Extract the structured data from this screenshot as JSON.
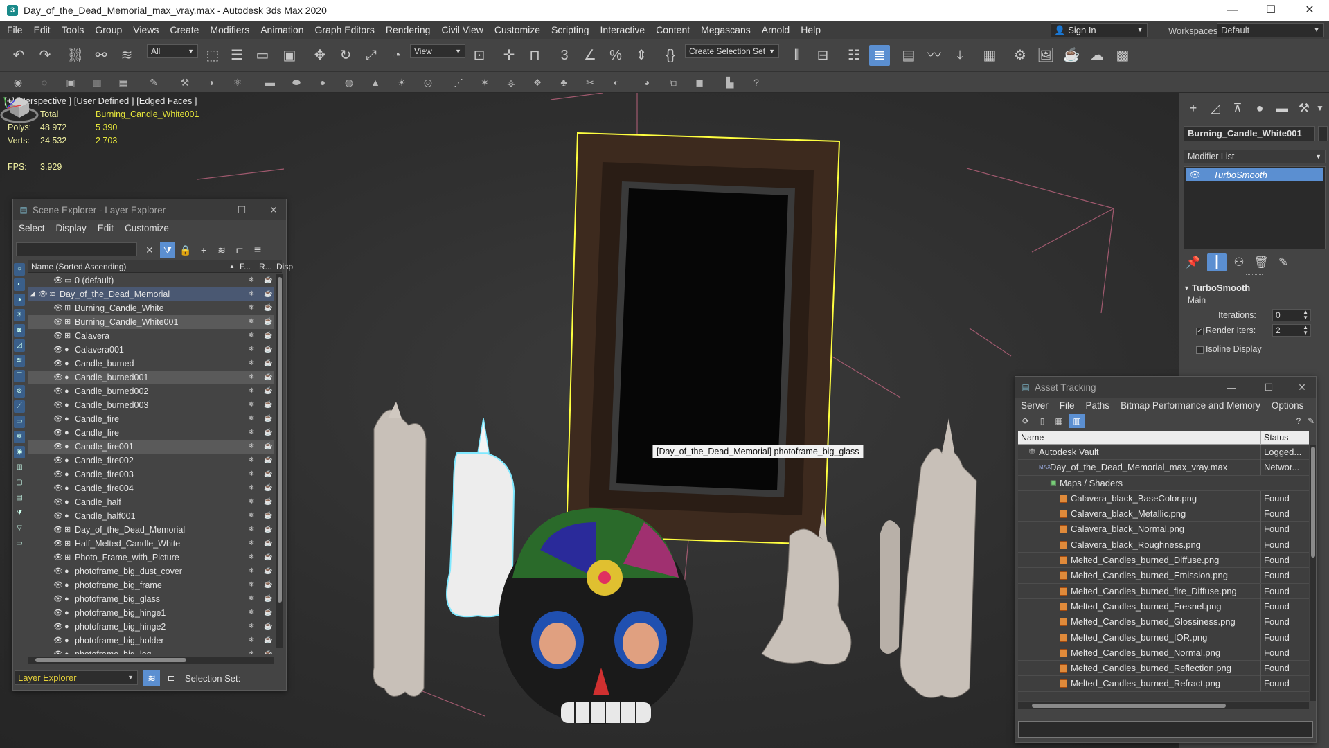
{
  "window": {
    "title": "Day_of_the_Dead_Memorial_max_vray.max - Autodesk 3ds Max 2020",
    "app_icon_letter": "3",
    "minimize": "—",
    "maximize": "☐",
    "close": "✕"
  },
  "menubar": {
    "items": [
      "File",
      "Edit",
      "Tools",
      "Group",
      "Views",
      "Create",
      "Modifiers",
      "Animation",
      "Graph Editors",
      "Rendering",
      "Civil View",
      "Customize",
      "Scripting",
      "Interactive",
      "Content",
      "Megascans",
      "Arnold",
      "Help"
    ],
    "sign_in": "Sign In",
    "workspaces_label": "Workspaces:",
    "workspace_value": "Default"
  },
  "toolbar": {
    "filter_value": "All",
    "refcoord_value": "View",
    "selection_set_placeholder": "Create Selection Set"
  },
  "viewport": {
    "label": "[+] [Perspective ] [User Defined ] [Edged Faces ]",
    "stats": {
      "total_label": "Total",
      "object_label": "Burning_Candle_White001",
      "polys_label": "Polys:",
      "polys_total": "48 972",
      "polys_obj": "5 390",
      "verts_label": "Verts:",
      "verts_total": "24 532",
      "verts_obj": "2 703",
      "fps_label": "FPS:",
      "fps_value": "3.929"
    },
    "tooltip": "[Day_of_the_Dead_Memorial] photoframe_big_glass"
  },
  "command_panel": {
    "object_name": "Burning_Candle_White001",
    "modifier_list_label": "Modifier List",
    "modifier_stack": [
      "TurboSmooth"
    ],
    "rollout_title": "TurboSmooth",
    "section_main": "Main",
    "iterations_label": "Iterations:",
    "iterations_value": "0",
    "render_iters_label": "Render Iters:",
    "render_iters_value": "2",
    "render_iters_checked": "✓",
    "isoline_label": "Isoline Display"
  },
  "scene_explorer": {
    "title": "Scene Explorer - Layer Explorer",
    "menus": [
      "Select",
      "Display",
      "Edit",
      "Customize"
    ],
    "col_name": "Name (Sorted Ascending)",
    "col_frozen": "F...",
    "col_render": "R...",
    "col_display": "Disp",
    "rows": [
      {
        "name": "0 (default)"
      },
      {
        "name": "Day_of_the_Dead_Memorial"
      },
      {
        "name": "Burning_Candle_White"
      },
      {
        "name": "Burning_Candle_White001"
      },
      {
        "name": "Calavera"
      },
      {
        "name": "Calavera001"
      },
      {
        "name": "Candle_burned"
      },
      {
        "name": "Candle_burned001"
      },
      {
        "name": "Candle_burned002"
      },
      {
        "name": "Candle_burned003"
      },
      {
        "name": "Candle_fire"
      },
      {
        "name": "Candle_fire"
      },
      {
        "name": "Candle_fire001"
      },
      {
        "name": "Candle_fire002"
      },
      {
        "name": "Candle_fire003"
      },
      {
        "name": "Candle_fire004"
      },
      {
        "name": "Candle_half"
      },
      {
        "name": "Candle_half001"
      },
      {
        "name": "Day_of_the_Dead_Memorial"
      },
      {
        "name": "Half_Melted_Candle_White"
      },
      {
        "name": "Photo_Frame_with_Picture"
      },
      {
        "name": "photoframe_big_dust_cover"
      },
      {
        "name": "photoframe_big_frame"
      },
      {
        "name": "photoframe_big_glass"
      },
      {
        "name": "photoframe_big_hinge1"
      },
      {
        "name": "photoframe_big_hinge2"
      },
      {
        "name": "photoframe_big_holder"
      },
      {
        "name": "photoframe_big_leg"
      }
    ],
    "footer_layer": "Layer Explorer",
    "selection_set_label": "Selection Set:"
  },
  "asset_tracking": {
    "title": "Asset Tracking",
    "menus": [
      "Server",
      "File",
      "Paths",
      "Bitmap Performance and Memory",
      "Options"
    ],
    "col_name": "Name",
    "col_status": "Status",
    "rows": [
      {
        "name": "Autodesk Vault",
        "status": "Logged..."
      },
      {
        "name": "Day_of_the_Dead_Memorial_max_vray.max",
        "status": "Networ..."
      },
      {
        "name": "Maps / Shaders",
        "status": ""
      },
      {
        "name": "Calavera_black_BaseColor.png",
        "status": "Found"
      },
      {
        "name": "Calavera_black_Metallic.png",
        "status": "Found"
      },
      {
        "name": "Calavera_black_Normal.png",
        "status": "Found"
      },
      {
        "name": "Calavera_black_Roughness.png",
        "status": "Found"
      },
      {
        "name": "Melted_Candles_burned_Diffuse.png",
        "status": "Found"
      },
      {
        "name": "Melted_Candles_burned_Emission.png",
        "status": "Found"
      },
      {
        "name": "Melted_Candles_burned_fire_Diffuse.png",
        "status": "Found"
      },
      {
        "name": "Melted_Candles_burned_Fresnel.png",
        "status": "Found"
      },
      {
        "name": "Melted_Candles_burned_Glossiness.png",
        "status": "Found"
      },
      {
        "name": "Melted_Candles_burned_IOR.png",
        "status": "Found"
      },
      {
        "name": "Melted_Candles_burned_Normal.png",
        "status": "Found"
      },
      {
        "name": "Melted_Candles_burned_Reflection.png",
        "status": "Found"
      },
      {
        "name": "Melted_Candles_burned_Refract.png",
        "status": "Found"
      }
    ]
  },
  "colors": {
    "accent": "#5b8fd1",
    "stats_yellow": "#e6e63a",
    "selection_yellow": "#ffff40",
    "selection_cyan": "#7fe8ff"
  }
}
